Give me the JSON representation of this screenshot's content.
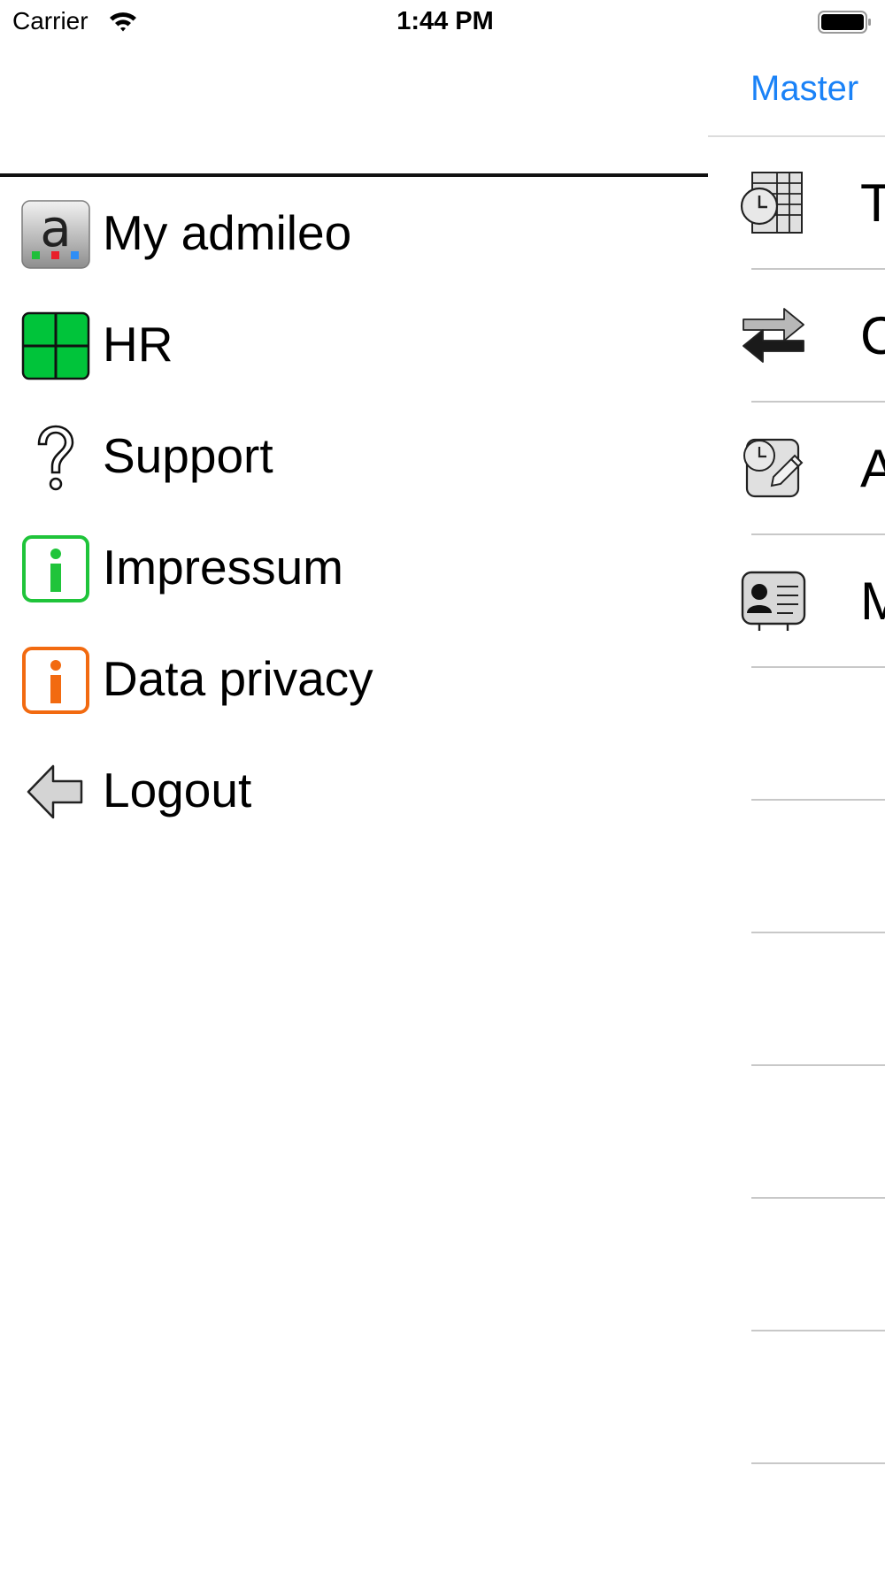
{
  "status_bar": {
    "carrier": "Carrier",
    "time": "1:44 PM",
    "wifi_icon": "wifi-icon",
    "battery_icon": "battery-icon"
  },
  "menu": {
    "items": [
      {
        "label": "My admileo",
        "icon": "admileo-logo-icon"
      },
      {
        "label": "HR",
        "icon": "hr-grid-icon",
        "color": "#00c43a"
      },
      {
        "label": "Support",
        "icon": "question-mark-icon"
      },
      {
        "label": "Impressum",
        "icon": "info-green-icon",
        "color": "#1fc43a"
      },
      {
        "label": "Data privacy",
        "icon": "info-orange-icon",
        "color": "#f26a10"
      },
      {
        "label": "Logout",
        "icon": "back-arrow-icon"
      }
    ]
  },
  "master": {
    "back_label": "Master",
    "accent_color": "#1a82f7",
    "rows": [
      {
        "label": "T",
        "icon": "timesheet-icon"
      },
      {
        "label": "C",
        "icon": "swap-arrows-icon"
      },
      {
        "label": "A",
        "icon": "time-edit-icon"
      },
      {
        "label": "M",
        "icon": "id-card-icon"
      }
    ]
  }
}
